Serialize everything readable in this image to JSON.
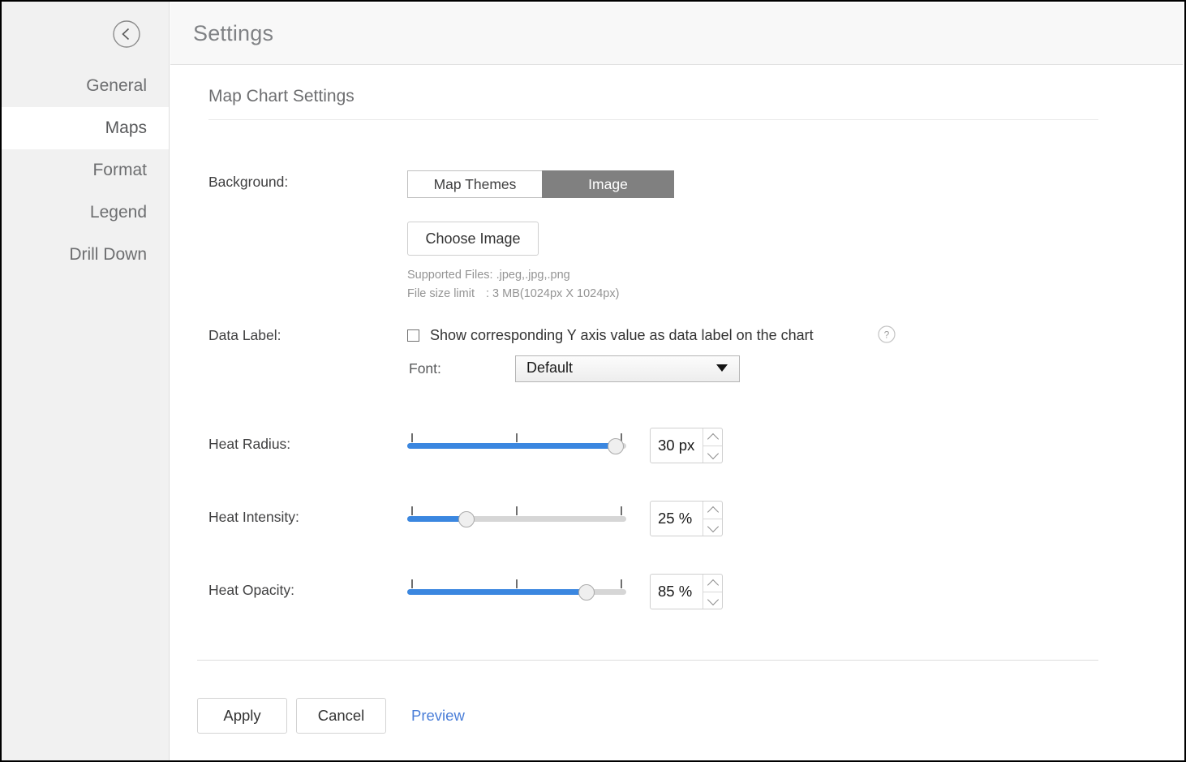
{
  "window": {
    "title": "Settings"
  },
  "sidebar": {
    "back_icon": "chevron-left-circle-icon",
    "items": [
      {
        "label": "General",
        "active": false
      },
      {
        "label": "Maps",
        "active": true
      },
      {
        "label": "Format",
        "active": false
      },
      {
        "label": "Legend",
        "active": false
      },
      {
        "label": "Drill Down",
        "active": false
      }
    ]
  },
  "main": {
    "section_title": "Map Chart Settings",
    "background": {
      "label": "Background:",
      "options": [
        "Map Themes",
        "Image"
      ],
      "selected": "Image",
      "choose_image_label": "Choose Image",
      "supported_files_note": "Supported Files: .jpeg,.jpg,.png",
      "file_size_note_label": "File size limit",
      "file_size_note_value": ": 3 MB(1024px X 1024px)"
    },
    "data_label": {
      "label": "Data Label:",
      "checkbox_label": "Show corresponding Y axis value as data label on the chart",
      "checked": false,
      "help_icon": "question-mark-icon",
      "font_label": "Font:",
      "font_value": "Default",
      "font_options": [
        "Default"
      ]
    },
    "heat_radius": {
      "label": "Heat Radius:",
      "value": "30 px",
      "percent": 95
    },
    "heat_intensity": {
      "label": "Heat Intensity:",
      "value": "25 %",
      "percent": 27
    },
    "heat_opacity": {
      "label": "Heat Opacity:",
      "value": "85 %",
      "percent": 82
    }
  },
  "footer": {
    "apply_label": "Apply",
    "cancel_label": "Cancel",
    "preview_label": "Preview"
  },
  "colors": {
    "accent_blue": "#3b87e0",
    "link_blue": "#4a7ed8",
    "selected_segment": "#808080",
    "sidebar_bg": "#f1f1f1",
    "header_bg": "#f8f8f8"
  }
}
